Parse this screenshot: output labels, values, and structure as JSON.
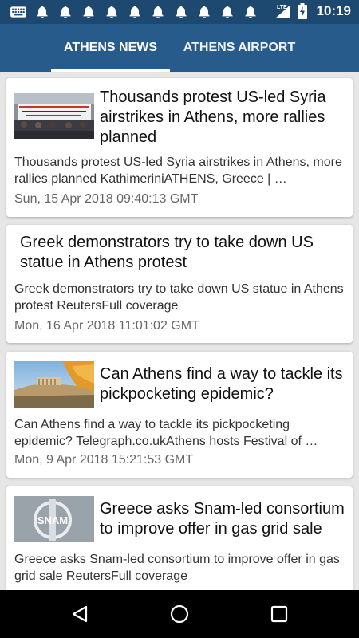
{
  "status_bar": {
    "time": "10:19",
    "notification_icons": [
      "keyboard-icon",
      "bell-icon",
      "bell-icon",
      "bell-icon",
      "bell-icon",
      "bell-icon",
      "bell-icon",
      "bell-icon",
      "bell-icon",
      "bell-icon",
      "bell-icon"
    ],
    "network": "LTE",
    "colors": {
      "background": "#1d4870"
    }
  },
  "tabs": [
    {
      "label": "ATHENS NEWS",
      "active": true
    },
    {
      "label": "ATHENS AIRPORT",
      "active": false
    }
  ],
  "colors": {
    "app_bar": "#275b8c",
    "background": "#e6e6e6"
  },
  "articles": [
    {
      "title": "Thousands protest US-led Syria airstrikes in Athens, more rallies planned",
      "summary": "Thousands protest US-led Syria airstrikes in Athens, more rallies planned  KathimeriniATHENS, Greece | …",
      "date": "Sun, 15 Apr 2018 09:40:13 GMT",
      "has_image": true,
      "image": "protest-photo"
    },
    {
      "title": "Greek demonstrators try to take down US statue in Athens protest",
      "summary": "Greek demonstrators try to take down US statue in Athens protest  ReutersFull coverage",
      "date": "Mon, 16 Apr 2018 11:01:02 GMT",
      "has_image": false
    },
    {
      "title": "Can Athens find a way to tackle its pickpocketing epidemic?",
      "summary": "Can Athens find a way to tackle its pickpocketing epidemic?  Telegraph.co.ukAthens hosts Festival of …",
      "date": "Mon, 9 Apr 2018 15:21:53 GMT",
      "has_image": true,
      "image": "acropolis-photo"
    },
    {
      "title": "Greece asks Snam-led consortium to improve offer in gas grid sale",
      "summary": "Greece asks Snam-led consortium to improve offer in gas grid sale  ReutersFull coverage",
      "has_image": true,
      "image": "snam-logo-photo",
      "image_text": "SNAM"
    }
  ],
  "nav": {
    "buttons": [
      "back-icon",
      "home-icon",
      "recents-icon"
    ]
  }
}
